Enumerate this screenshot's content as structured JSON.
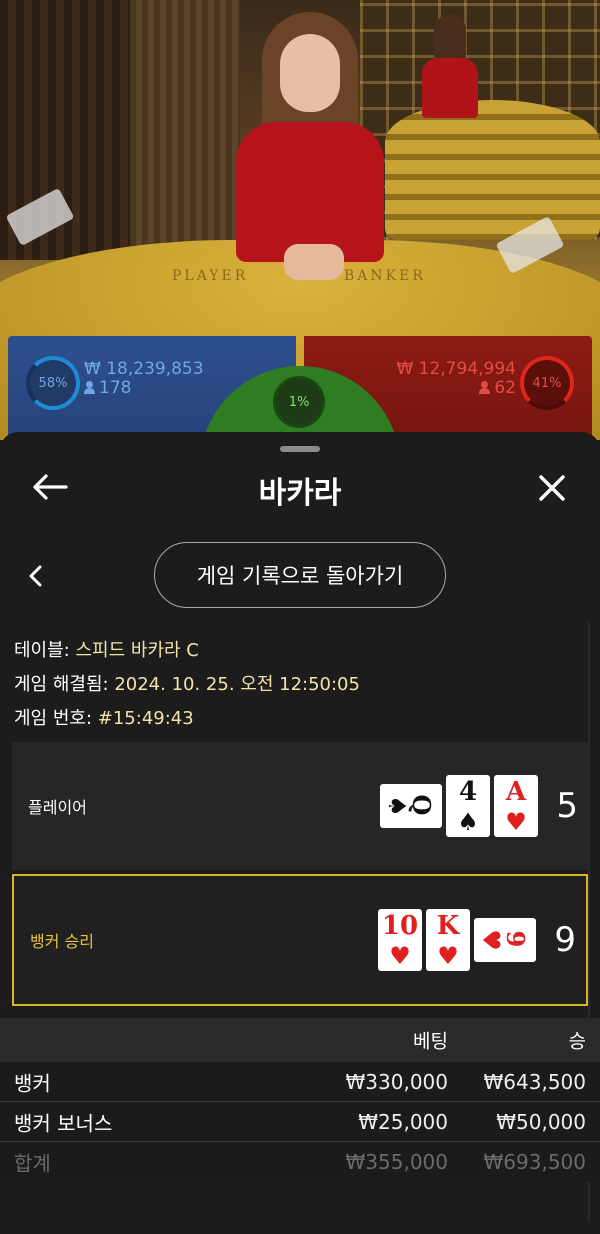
{
  "video": {
    "table_labels": {
      "player": "PLAYER",
      "banker": "BANKER"
    }
  },
  "bet_stats": {
    "player": {
      "percent": "58%",
      "amount": "₩ 18,239,853",
      "players": "178",
      "color": "#1f8ad8"
    },
    "tie": {
      "percent": "1%",
      "color": "#2f7d22"
    },
    "banker": {
      "percent": "41%",
      "amount": "₩ 12,794,994",
      "players": "62",
      "color": "#e0251b"
    }
  },
  "sheet": {
    "title": "바카라",
    "back_icon": "arrow-left-icon",
    "close_icon": "close-icon",
    "history_button": "게임 기록으로 돌아가기",
    "info": {
      "table_label": "테이블:",
      "table_value": "스피드 바카라 C",
      "resolved_label": "게임 해결됨:",
      "resolved_value": "2024. 10. 25. 오전 12:50:05",
      "game_no_label": "게임 번호:",
      "game_no_value": "#15:49:43"
    },
    "hands": {
      "player": {
        "label": "플레이어",
        "score": "5",
        "cards": [
          {
            "rank": "Q",
            "suit": "♠",
            "color": "black",
            "sideways": true
          },
          {
            "rank": "4",
            "suit": "♠",
            "color": "black",
            "sideways": false
          },
          {
            "rank": "A",
            "suit": "♥",
            "color": "red",
            "sideways": false
          }
        ]
      },
      "banker": {
        "label": "뱅커 승리",
        "score": "9",
        "cards": [
          {
            "rank": "10",
            "suit": "♥",
            "color": "red",
            "sideways": false
          },
          {
            "rank": "K",
            "suit": "♥",
            "color": "red",
            "sideways": false
          },
          {
            "rank": "9",
            "suit": "♥",
            "color": "red",
            "sideways": true
          }
        ]
      }
    },
    "bets": {
      "headers": {
        "bet": "베팅",
        "win": "승"
      },
      "rows": [
        {
          "name": "뱅커",
          "bet": "₩330,000",
          "win": "₩643,500"
        },
        {
          "name": "뱅커 보너스",
          "bet": "₩25,000",
          "win": "₩50,000"
        }
      ],
      "total": {
        "name": "합계",
        "bet": "₩355,000",
        "win": "₩693,500"
      }
    },
    "accent_color": "#d9b526"
  }
}
